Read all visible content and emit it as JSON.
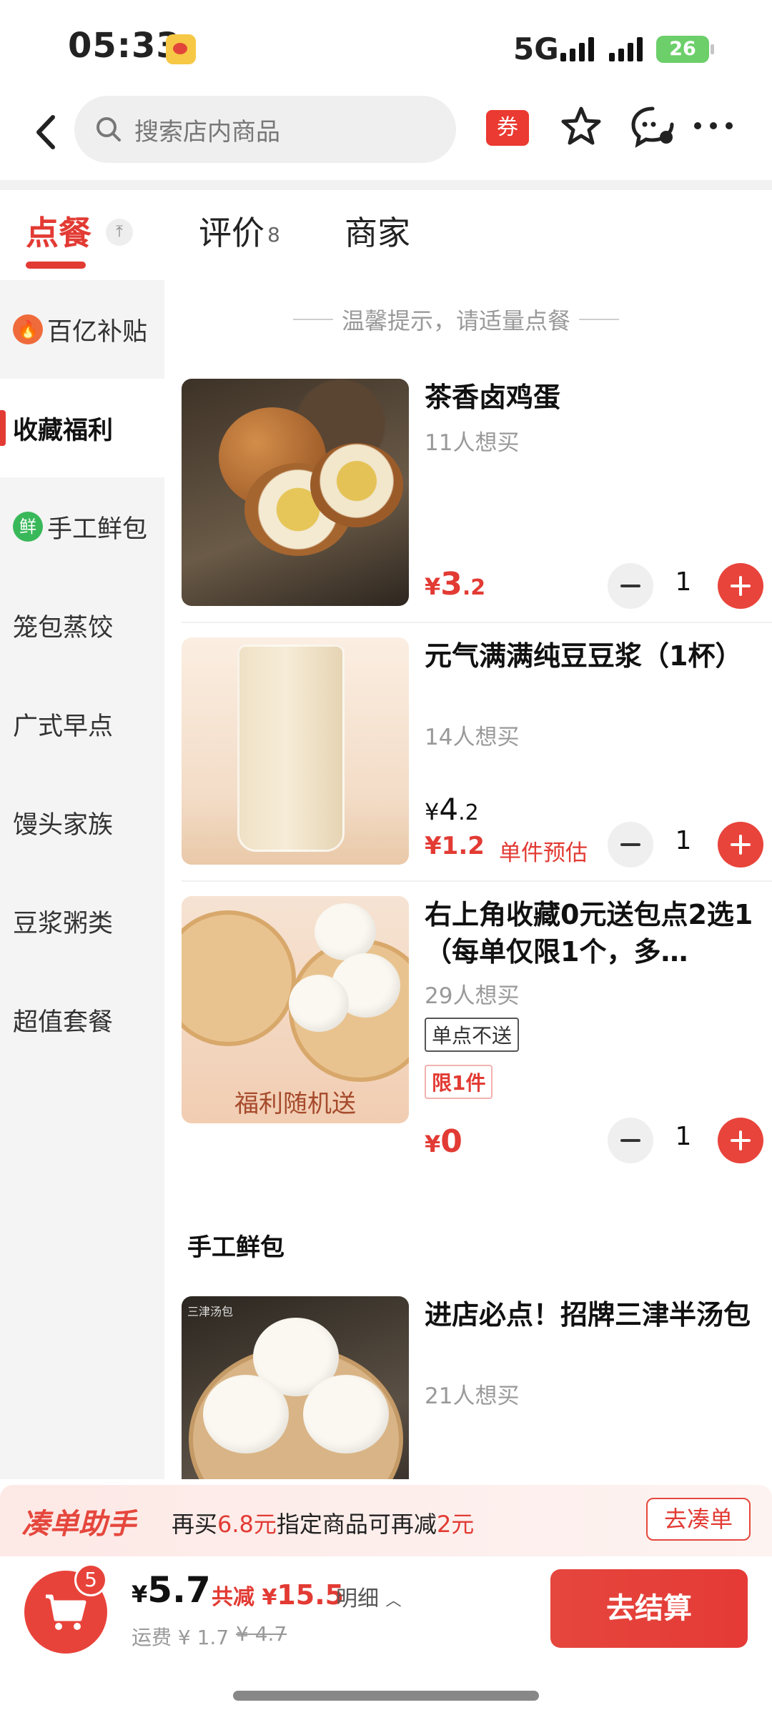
{
  "status_bar": {
    "time": "05:33",
    "network": "5G",
    "battery": "26"
  },
  "search": {
    "placeholder": "搜索店内商品"
  },
  "top_nav": {
    "coupon_label": "券"
  },
  "tabs": {
    "order": "点餐",
    "reviews": "评价",
    "reviews_count": "8",
    "merchant": "商家"
  },
  "sidebar": {
    "items": [
      {
        "label": "百亿补贴",
        "icon": "fire-icon"
      },
      {
        "label": "收藏福利"
      },
      {
        "label": "手工鲜包",
        "icon_text": "鲜"
      },
      {
        "label": "笼包蒸饺"
      },
      {
        "label": "广式早点"
      },
      {
        "label": "馒头家族"
      },
      {
        "label": "豆浆粥类"
      },
      {
        "label": "超值套餐"
      }
    ]
  },
  "notice": "温馨提示，请适量点餐",
  "products": [
    {
      "name": "茶香卤鸡蛋",
      "wants": "11人想买",
      "price_symbol": "¥",
      "price_int": "3",
      "price_dec": ".2",
      "qty": "1"
    },
    {
      "name": "元气满满纯豆豆浆（1杯）",
      "wants": "14人想买",
      "price_symbol": "¥",
      "price_int": "4",
      "price_dec": ".2",
      "estimate": "¥1.2",
      "estimate_label": "单件预估",
      "qty": "1"
    },
    {
      "name": "右上角收藏0元送包点2选1（每单仅限1个，多…",
      "wants": "29人想买",
      "tag": "单点不送",
      "limit": "限1件",
      "thumb_caption": "福利随机送",
      "price_symbol": "¥",
      "price_int": "0",
      "qty": "1"
    },
    {
      "name": "进店必点！招牌三津半汤包",
      "wants": "21人想买",
      "thumb_label": "三津汤包"
    }
  ],
  "section_title": "手工鲜包",
  "promo": {
    "logo": "凑单助手",
    "text_before": "再买",
    "amount": "6.8元",
    "text_middle": "指定商品可再减",
    "discount": "2元",
    "button": "去凑单"
  },
  "checkout": {
    "cart_count": "5",
    "total_symbol": "¥",
    "total": "5.7",
    "discount_label": "共减 ¥",
    "discount_value": "15.5",
    "detail": "明细",
    "delivery": "运费 ¥ 1.7",
    "delivery_old": "¥ 4.7",
    "button": "去结算"
  },
  "colors": {
    "accent": "#e23b34",
    "sidebar_bg": "#f4f4f4"
  }
}
